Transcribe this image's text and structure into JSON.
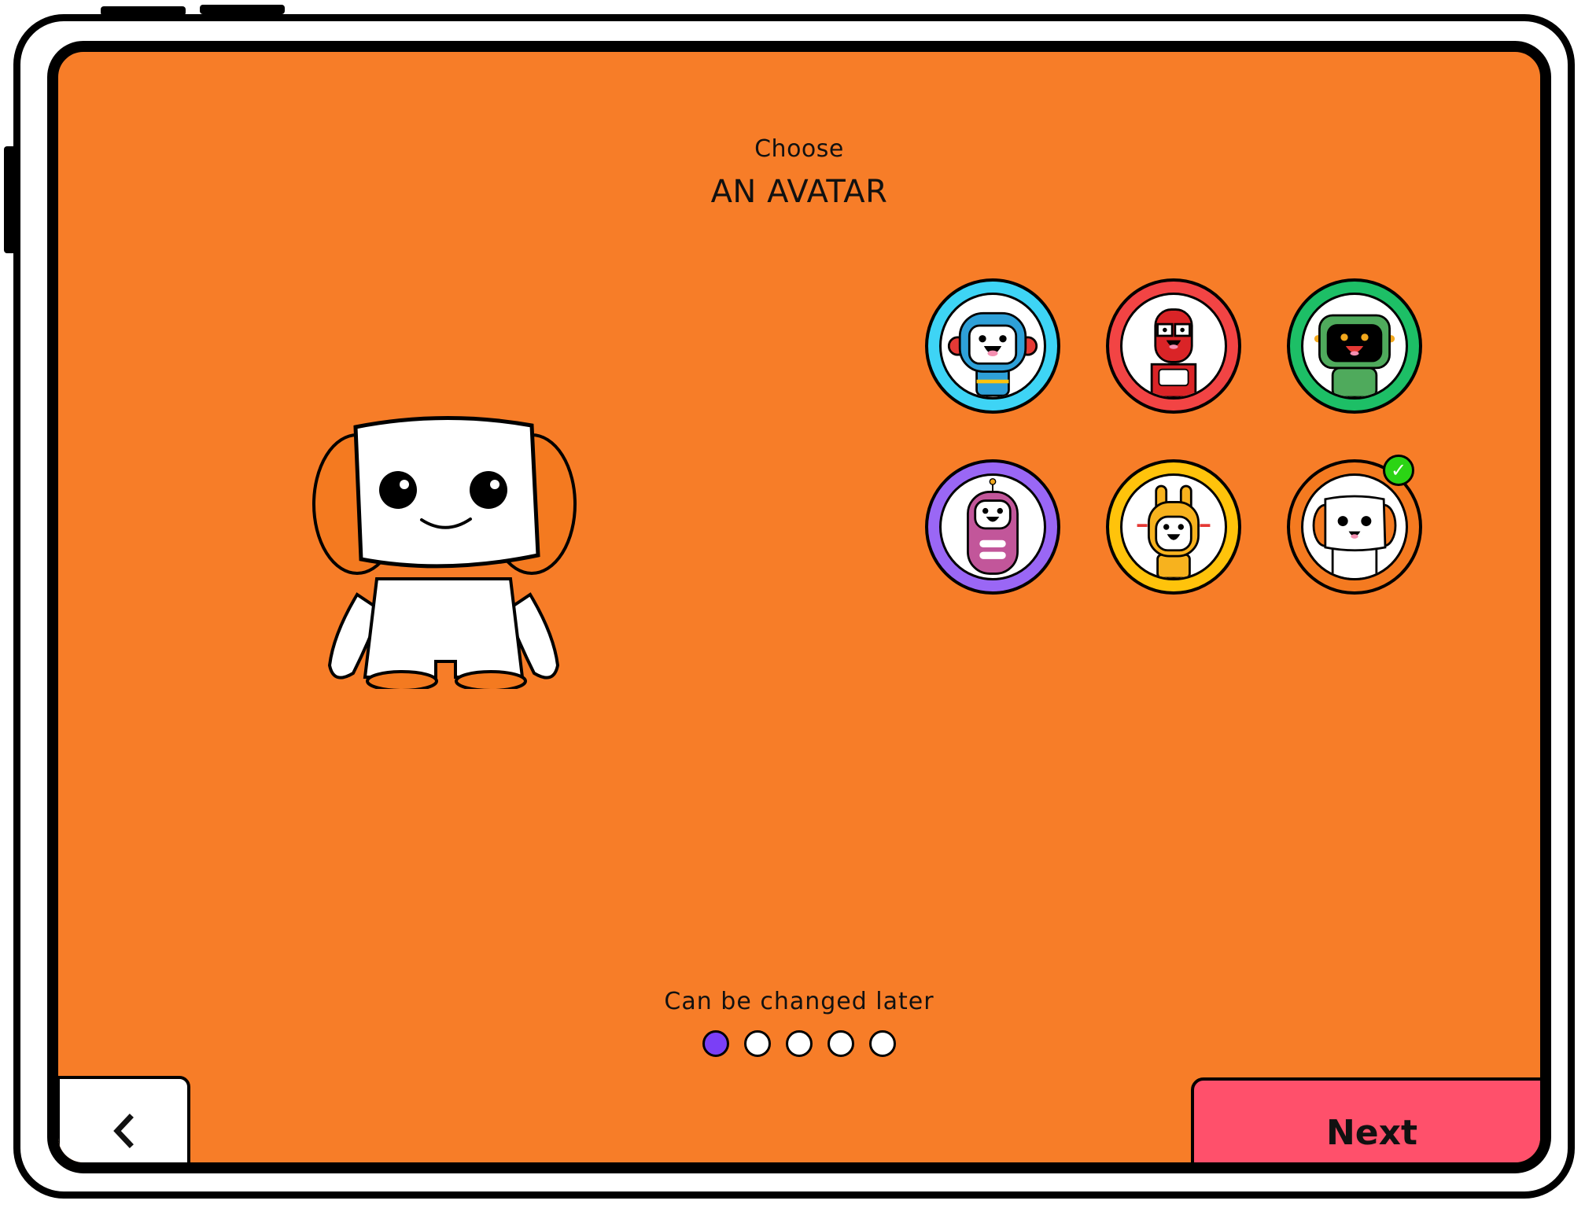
{
  "header": {
    "title_small": "Choose",
    "title_big": "AN AVATAR"
  },
  "hero": {
    "avatar_name": "white-orange-robot",
    "body_color": "#FFFFFF",
    "accent_color": "#F47A20"
  },
  "avatars": [
    {
      "name": "blue-astronaut",
      "ring_color": "#3ED4F5",
      "accent_color": "#2EA0D8",
      "selected": false
    },
    {
      "name": "red-glasses-robot",
      "ring_color": "#F24444",
      "accent_color": "#DA2427",
      "selected": false
    },
    {
      "name": "green-screen-robot",
      "ring_color": "#1DBF66",
      "accent_color": "#4FAA5C",
      "selected": false
    },
    {
      "name": "pink-capsule-robot",
      "ring_color": "#9A67F5",
      "accent_color": "#C2569A",
      "selected": false
    },
    {
      "name": "yellow-bunny-robot",
      "ring_color": "#FFC30B",
      "accent_color": "#F7B21E",
      "selected": false
    },
    {
      "name": "white-orange-robot",
      "ring_color": "#F47A20",
      "accent_color": "#F47A20",
      "selected": true
    }
  ],
  "selected_badge": {
    "icon": "checkmark-icon",
    "glyph": "✓",
    "color": "#2BD414"
  },
  "footer": {
    "hint": "Can be changed later",
    "progress": {
      "current_step": 1,
      "total_steps": 5,
      "active_color": "#7B3FF6"
    },
    "back_icon": "chevron-left-icon",
    "next_label": "Next"
  },
  "colors": {
    "background": "#F77D28",
    "next_button": "#FF506B"
  }
}
